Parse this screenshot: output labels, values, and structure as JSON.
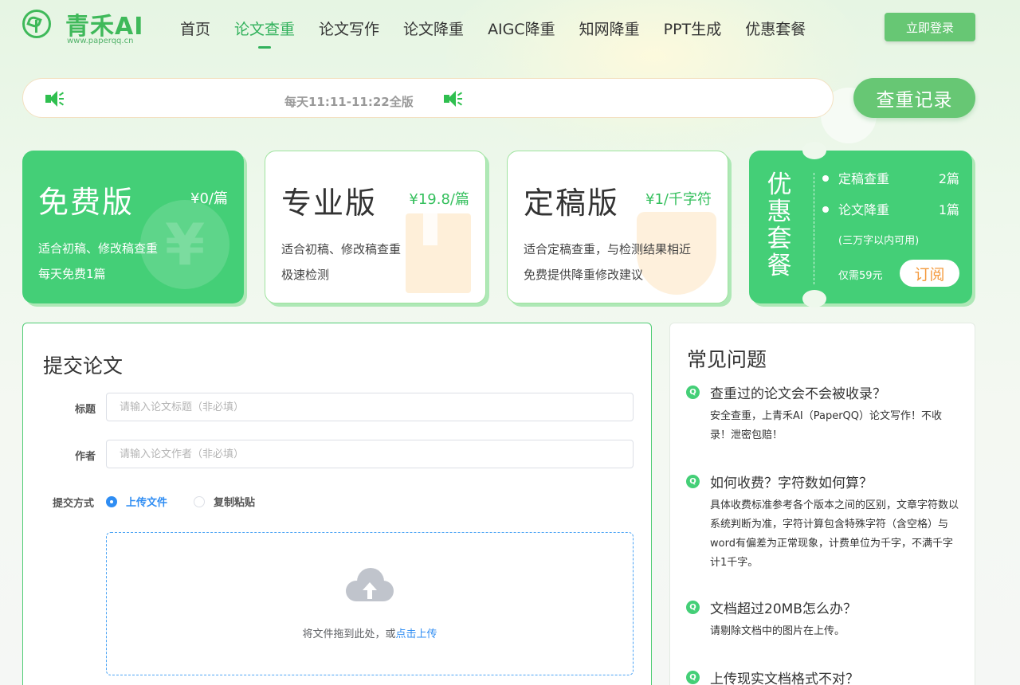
{
  "header": {
    "logo_text": "青禾AI",
    "logo_sub": "www.paperqq.cn",
    "nav": [
      "首页",
      "论文查重",
      "论文写作",
      "论文降重",
      "AIGC降重",
      "知网降重",
      "PPT生成",
      "优惠套餐"
    ],
    "active_nav": "论文查重",
    "login_label": "立即登录"
  },
  "notice": {
    "text": "每天11:11-11:22全版",
    "record_label": "查重记录"
  },
  "plans": [
    {
      "title": "免费版",
      "price": "¥0/篇",
      "line1": "适合初稿、修改稿查重",
      "line2": "每天免费1篇",
      "deco": "¥"
    },
    {
      "title": "专业版",
      "price": "¥19.8/篇",
      "line1": "适合初稿、修改稿查重",
      "line2": "极速检测"
    },
    {
      "title": "定稿版",
      "price": "¥1/千字符",
      "line1": "适合定稿查重，与检测结果相近",
      "line2": "免费提供降重修改建议"
    }
  ],
  "package": {
    "title": "优惠套餐",
    "items": [
      {
        "label": "定稿查重",
        "count": "2篇"
      },
      {
        "label": "论文降重",
        "count": "1篇"
      }
    ],
    "note": "(三万字以内可用)",
    "price": "仅需59元",
    "subscribe_label": "订阅"
  },
  "submit": {
    "title": "提交论文",
    "title_label": "标题",
    "title_placeholder": "请输入论文标题（非必填）",
    "author_label": "作者",
    "author_placeholder": "请输入论文作者（非必填）",
    "method_label": "提交方式",
    "method_upload": "上传文件",
    "method_paste": "复制粘贴",
    "selected_method": "上传文件",
    "upload_text": "将文件拖到此处，或",
    "upload_link": "点击上传"
  },
  "faq": {
    "title": "常见问题",
    "items": [
      {
        "q": "查重过的论文会不会被收录？",
        "a": "安全查重，上青禾AI（PaperQQ）论文写作！不收录！泄密包赔！"
      },
      {
        "q": "如何收费？字符数如何算？",
        "a": "具体收费标准参考各个版本之间的区别，文章字符数以系统判断为准，字符计算包含特殊字符（含空格）与word有偏差为正常现象，计费单位为千字，不满千字计1千字。"
      },
      {
        "q": "文档超过20MB怎么办？",
        "a": "请剔除文档中的图片在上传。"
      },
      {
        "q": "上传现实文档格式不对？",
        "a": ""
      }
    ]
  },
  "colors": {
    "brand": "#44cf77",
    "brand_dark": "#31b15b",
    "link": "#2f8df3",
    "accent_orange": "#f49a3d"
  },
  "icons": [
    "logo-sprout-icon",
    "speaker-icon",
    "upload-cloud-icon",
    "question-icon"
  ]
}
